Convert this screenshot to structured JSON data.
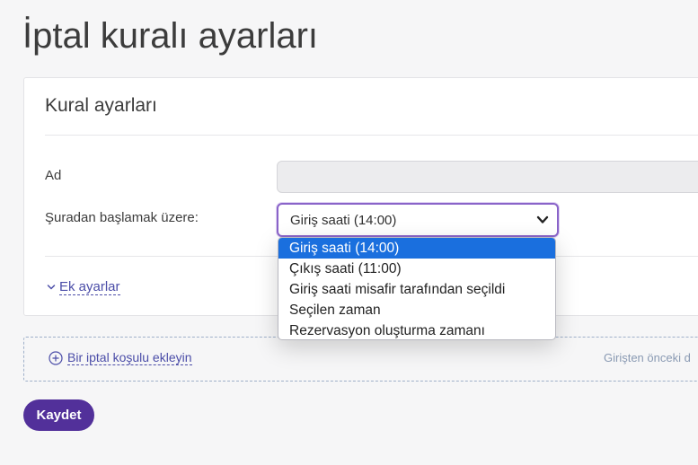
{
  "page": {
    "title": "İptal kuralı ayarları"
  },
  "card": {
    "title": "Kural ayarları",
    "fields": {
      "ad_label": "Ad",
      "ad_value": "",
      "start_label": "Şuradan başlamak üzere:",
      "start_selected": "Giriş saati (14:00)"
    },
    "dropdown_options": [
      "Giriş saati (14:00)",
      "Çıkış saati (11:00)",
      "Giriş saati misafir tarafından seçildi",
      "Seçilen zaman",
      "Rezervasyon oluşturma zamanı"
    ],
    "extra_settings_label": "Ek ayarlar"
  },
  "conditions": {
    "add_label": "Bir iptal koşulu ekleyin",
    "right_hint": "Girişten önceki d"
  },
  "actions": {
    "save_label": "Kaydet"
  },
  "colors": {
    "accent": "#52309a",
    "link": "#4b4da8",
    "selected_option": "#1a6fde",
    "focus_border": "#8a64c9"
  },
  "icons": {
    "select_arrow": "chevron-down-icon",
    "extra_settings": "chevron-down-icon",
    "add_condition": "plus-circle-icon"
  }
}
